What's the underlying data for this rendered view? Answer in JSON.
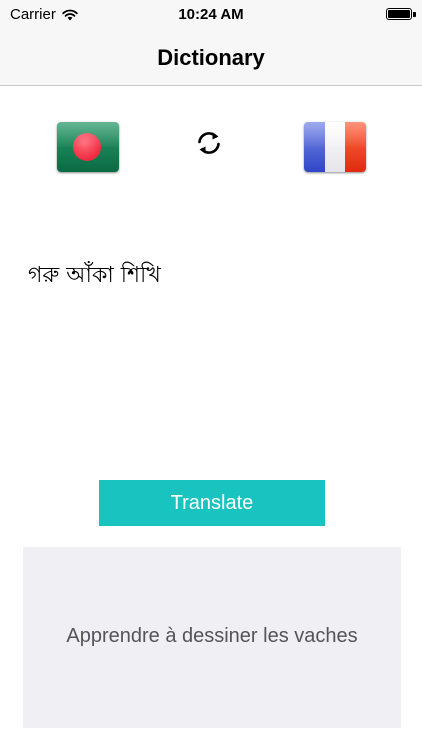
{
  "status_bar": {
    "carrier": "Carrier",
    "time": "10:24 AM",
    "icons": [
      "wifi-icon",
      "battery-icon"
    ]
  },
  "nav": {
    "title": "Dictionary"
  },
  "languages": {
    "source_flag": "bangladesh-flag",
    "target_flag": "france-flag",
    "swap_icon": "swap-arrows-icon"
  },
  "input": {
    "text": "গরু আঁকা শিখি"
  },
  "actions": {
    "translate_label": "Translate"
  },
  "output": {
    "text": "Apprendre à dessiner les vaches"
  },
  "colors": {
    "accent": "#19c3bf",
    "output_background": "#efeff4",
    "bar_background": "#f7f7f7"
  }
}
